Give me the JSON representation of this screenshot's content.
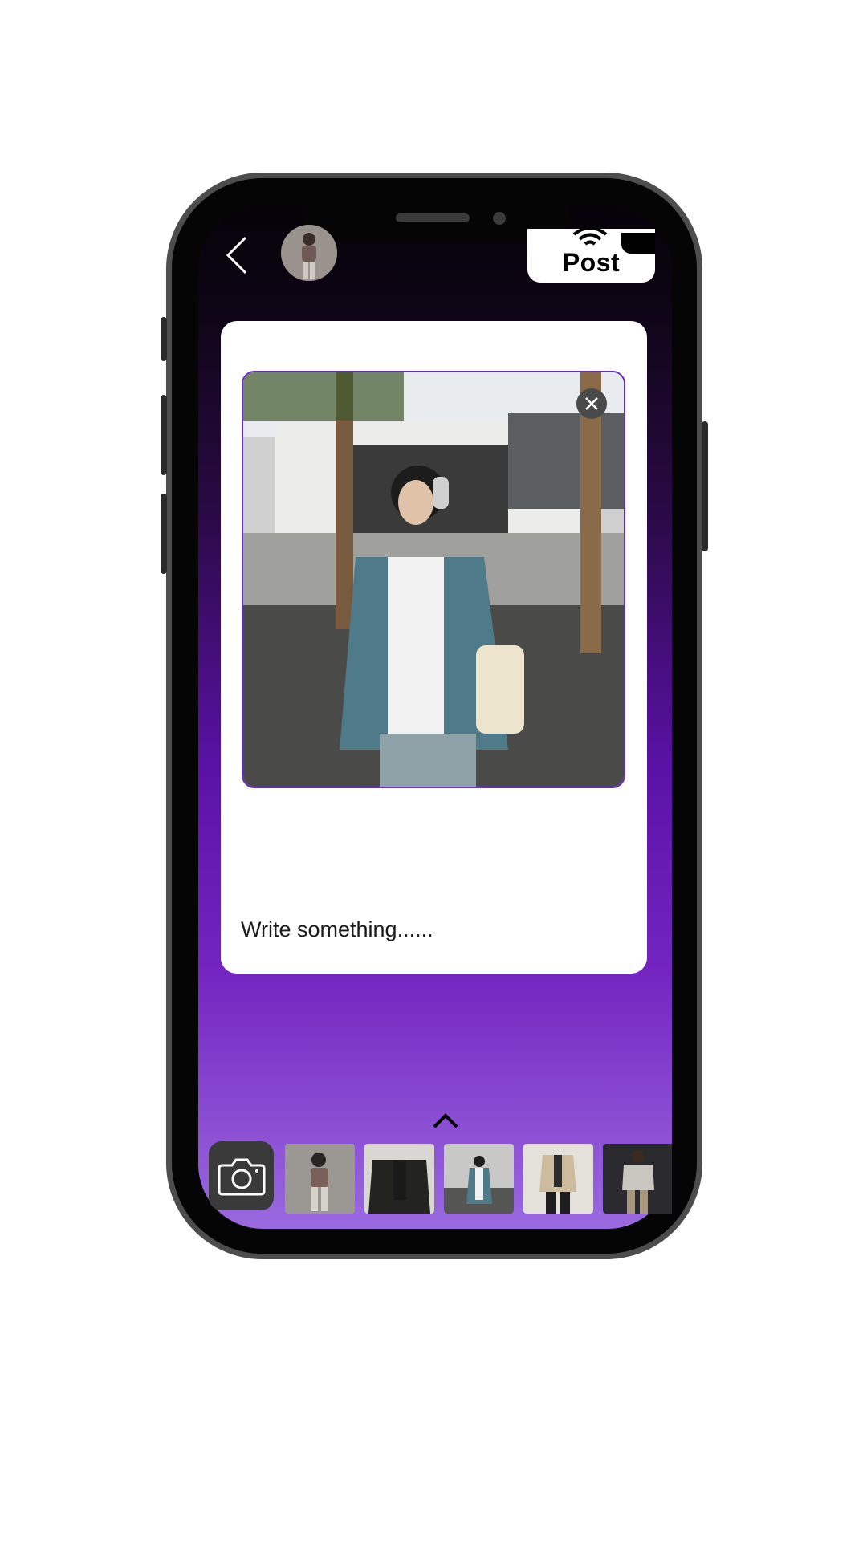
{
  "header": {
    "post_label": "Post",
    "back_icon": "chevron-left-icon",
    "avatar_alt": "profile-photo"
  },
  "composer": {
    "placeholder": "Write something......",
    "close_icon": "close-icon"
  },
  "tray": {
    "expand_icon": "chevron-up-icon",
    "camera_icon": "camera-icon",
    "thumbnails": [
      "thumb-1",
      "thumb-2",
      "thumb-3",
      "thumb-4",
      "thumb-5"
    ]
  },
  "colors": {
    "accent": "#6a2ec8",
    "gradient_bottom": "#9a6ae0"
  }
}
